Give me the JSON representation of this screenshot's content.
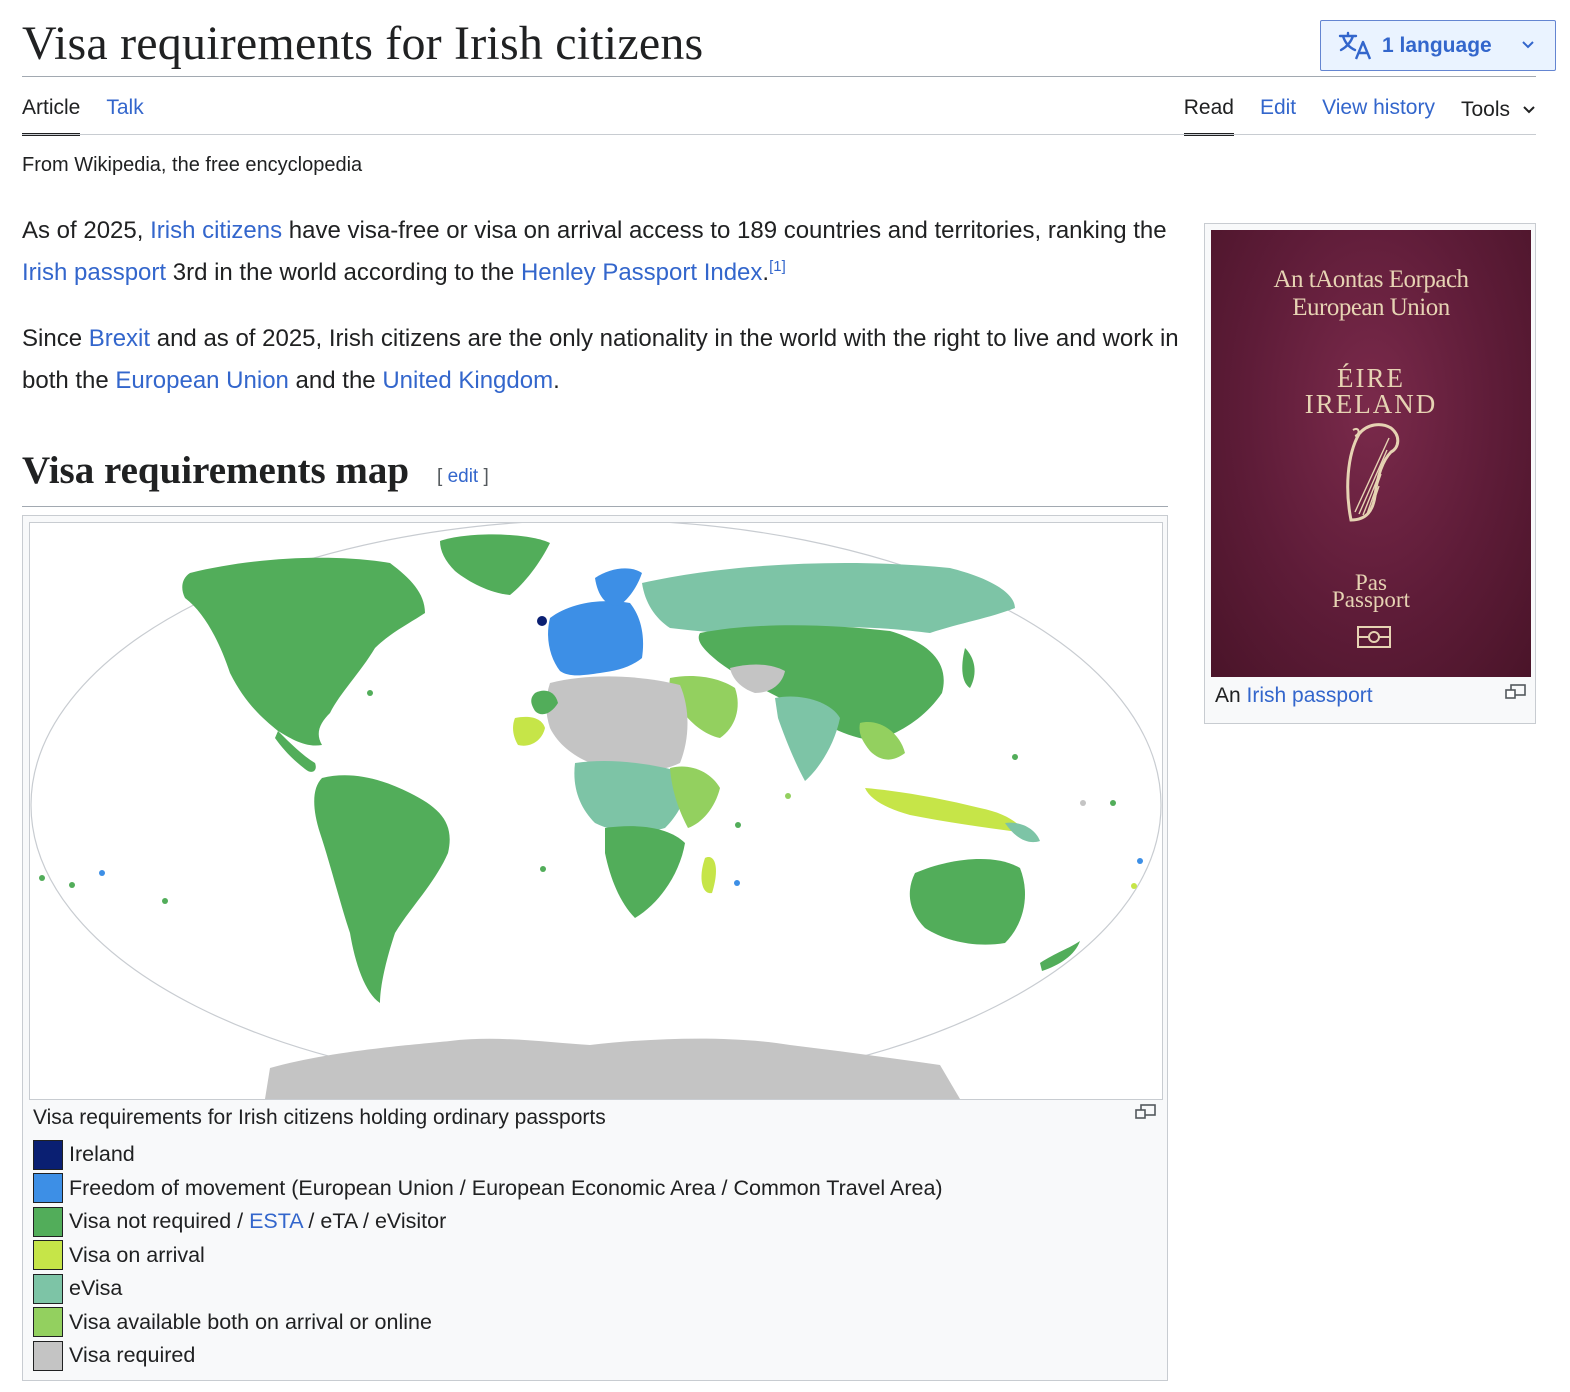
{
  "page": {
    "title": "Visa requirements for Irish citizens",
    "tagline": "From Wikipedia, the free encyclopedia"
  },
  "language_button": {
    "label": "1 language",
    "icon": "translate-icon"
  },
  "tabs": {
    "article": "Article",
    "talk": "Talk",
    "read": "Read",
    "edit": "Edit",
    "view_history": "View history",
    "tools": "Tools"
  },
  "intro": {
    "p1": {
      "t1": "As of 2025, ",
      "link1": "Irish citizens",
      "t2": " have visa-free or visa on arrival access to 189 countries and territories, ranking the ",
      "link2": "Irish passport",
      "t3": " 3rd in the world according to the ",
      "link3": "Henley Passport Index",
      "t4": ".",
      "ref": "[1]"
    },
    "p2": {
      "t1": "Since ",
      "link1": "Brexit",
      "t2": " and as of 2025, Irish citizens are the only nationality in the world with the right to live and work in both the ",
      "link2": "European Union",
      "t3": " and the ",
      "link3": "United Kingdom",
      "t4": "."
    }
  },
  "section": {
    "heading": "Visa requirements map",
    "edit_open": "[ ",
    "edit_label": "edit",
    "edit_close": " ]"
  },
  "map": {
    "caption": "Visa requirements for Irish citizens holding ordinary passports",
    "legend": [
      {
        "color": "#0a1f72",
        "label": "Ireland"
      },
      {
        "color": "#3d8fe6",
        "label": "Freedom of movement (European Union / European Economic Area / Common Travel Area)"
      },
      {
        "color": "#52ad5a",
        "label_pre": "Visa not required / ",
        "label_link": "ESTA",
        "label_post": " / eTA / eVisitor"
      },
      {
        "color": "#c6e548",
        "label": "Visa on arrival"
      },
      {
        "color": "#7dc4a6",
        "label": "eVisa"
      },
      {
        "color": "#93d05f",
        "label": "Visa available both on arrival or online"
      },
      {
        "color": "#c4c4c4",
        "label": "Visa required"
      }
    ]
  },
  "infobox": {
    "passport": {
      "org_ga": "An tAontas Eorpach",
      "org_en": "European Union",
      "country_ga": "ÉIRE",
      "country_en": "IRELAND",
      "doc_ga": "Pas",
      "doc_en": "Passport"
    },
    "caption_pre": "An ",
    "caption_link": "Irish passport"
  }
}
